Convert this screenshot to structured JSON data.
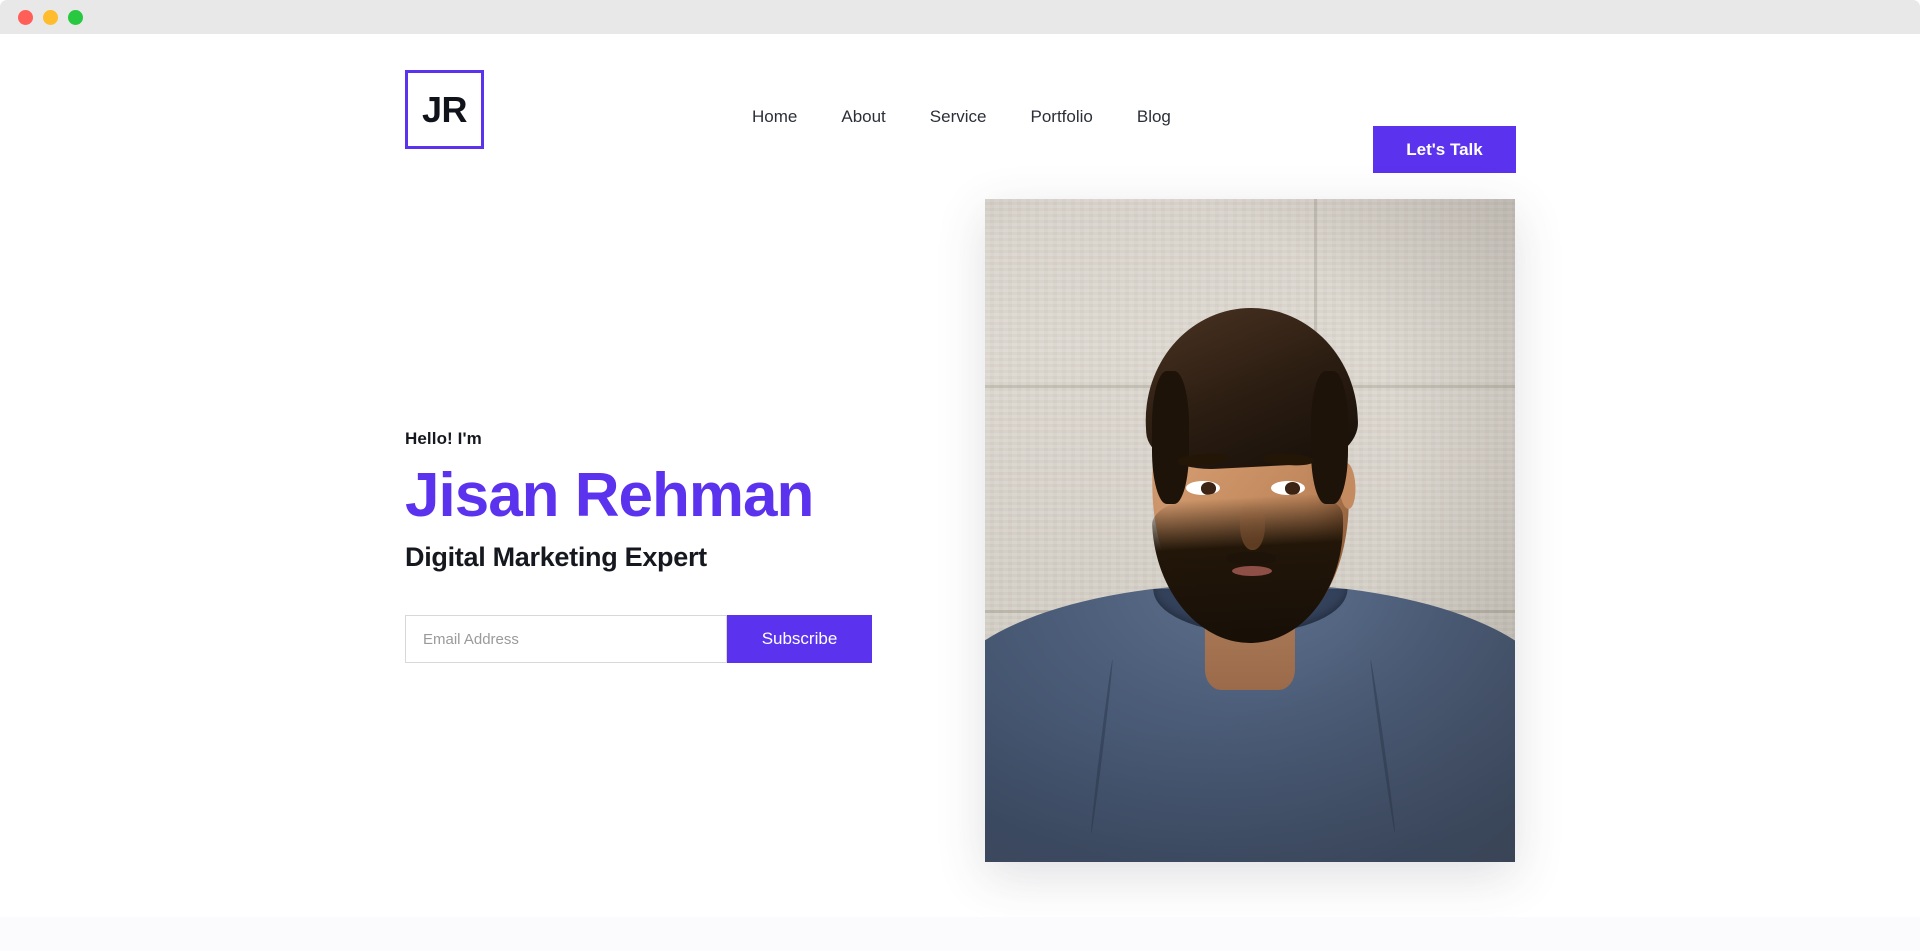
{
  "window": {
    "traffic_lights": [
      {
        "name": "close",
        "color": "#ff5f57"
      },
      {
        "name": "minimize",
        "color": "#febc2e"
      },
      {
        "name": "maximize",
        "color": "#28c840"
      }
    ]
  },
  "header": {
    "logo_text": "JR",
    "nav": [
      {
        "label": "Home"
      },
      {
        "label": "About"
      },
      {
        "label": "Service"
      },
      {
        "label": "Portfolio"
      },
      {
        "label": "Blog"
      }
    ],
    "cta_label": "Let's Talk"
  },
  "hero": {
    "greeting": "Hello! I'm",
    "name": "Jisan Rehman",
    "role": "Digital Marketing Expert",
    "form": {
      "email_placeholder": "Email Address",
      "email_value": "",
      "subscribe_label": "Subscribe"
    },
    "portrait_alt": "Portrait of Jisan Rehman"
  },
  "colors": {
    "accent": "#5b33ee",
    "text_dark": "#16181f",
    "nav_text": "#2b2f38",
    "input_border": "#d8d8d8",
    "placeholder": "#9a9a9a",
    "chrome_bg": "#e8e8e8",
    "band_bg": "#fbfbfd"
  }
}
